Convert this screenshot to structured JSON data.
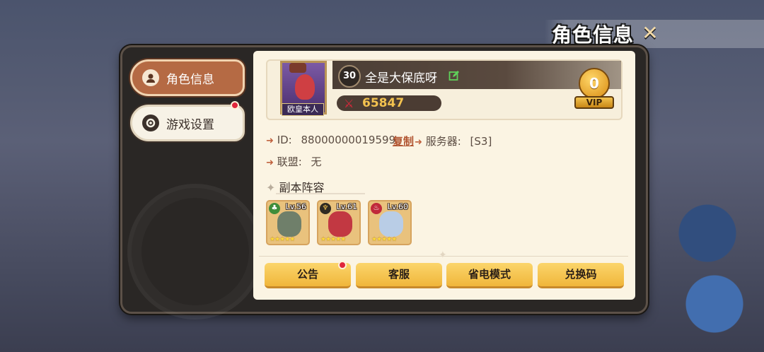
{
  "header": {
    "title": "角色信息",
    "close_icon": "close-icon"
  },
  "sidebar": {
    "items": [
      {
        "label": "角色信息",
        "icon": "user-icon",
        "active": true
      },
      {
        "label": "游戏设置",
        "icon": "settings-icon",
        "active": false,
        "notification": true
      }
    ]
  },
  "profile": {
    "avatar_tag": "欧皇本人",
    "level": "30",
    "name": "全是大保底呀",
    "power": "65847",
    "vip_level": "0",
    "vip_label": "VIP"
  },
  "info": {
    "id_label": "ID:",
    "id_value": "88000000019599",
    "copy_label": "复制",
    "server_label": "服务器:",
    "server_value": "[S3]",
    "alliance_label": "联盟:",
    "alliance_value": "无"
  },
  "team": {
    "title": "副本阵容",
    "heroes": [
      {
        "level": "Lv.56",
        "stars": 5,
        "element_color": "#3f8d3a",
        "sprite_color": "#6f7f6a"
      },
      {
        "level": "Lv.61",
        "stars": 5,
        "element_color": "#2f2a22",
        "sprite_color": "#c23842"
      },
      {
        "level": "Lv.60",
        "stars": 5,
        "element_color": "#c0293a",
        "sprite_color": "#b9cde6"
      }
    ]
  },
  "buttons": [
    {
      "label": "公告",
      "notification": true
    },
    {
      "label": "客服"
    },
    {
      "label": "省电模式"
    },
    {
      "label": "兑换码"
    }
  ],
  "colors": {
    "accent": "#f0b63b",
    "active_tab": "#b56a44",
    "panel": "#fbf4e3",
    "power": "#f3c24f"
  }
}
